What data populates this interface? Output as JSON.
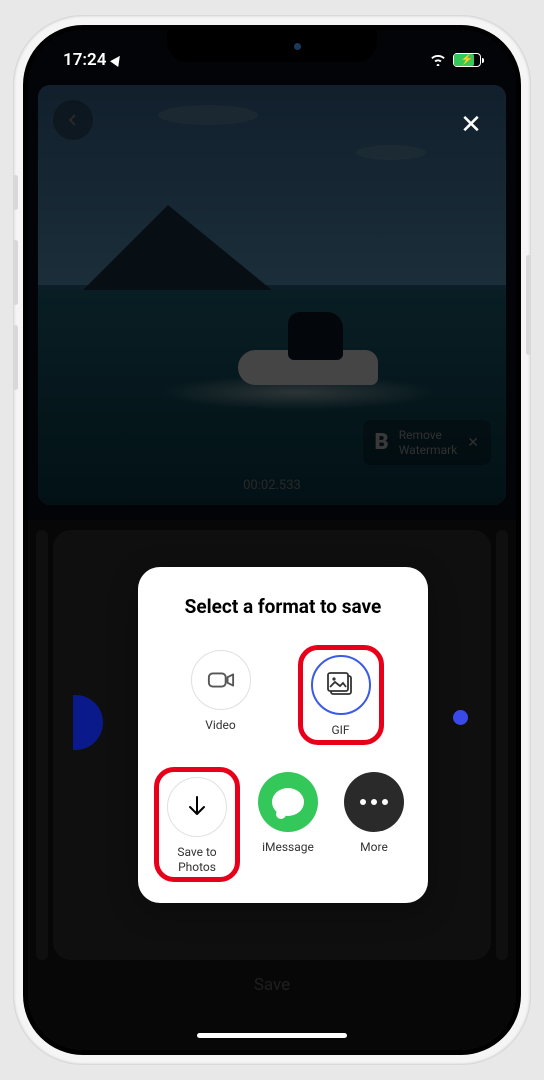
{
  "status": {
    "time": "17:24",
    "battery_charging": true
  },
  "video": {
    "timestamp": "00:02.533",
    "watermark": {
      "brand": "B",
      "line1": "Remove",
      "line2": "Watermark"
    }
  },
  "bottom": {
    "save_label": "Save"
  },
  "modal": {
    "title": "Select a format to save",
    "formats": {
      "video": "Video",
      "gif": "GIF"
    },
    "actions": {
      "save_photos": "Save to Photos",
      "imessage": "iMessage",
      "more": "More"
    }
  }
}
